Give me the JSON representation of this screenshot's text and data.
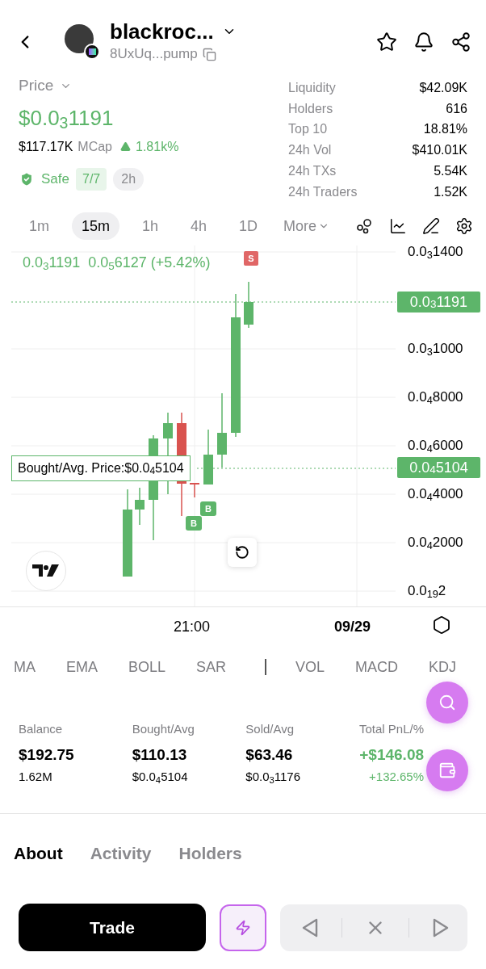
{
  "header": {
    "name": "blackroc...",
    "address": "8UxUq...pump"
  },
  "price": {
    "label": "Price",
    "value": "$0.0$_{3}$1191",
    "mcap": "$117.17K",
    "mcap_label": "MCap",
    "change": "1.81k%",
    "safe": true,
    "safe_label": "Safe",
    "checks": "7/7",
    "age": "2h"
  },
  "stats": [
    {
      "label": "Liquidity",
      "value": "$42.09K"
    },
    {
      "label": "Holders",
      "value": "616"
    },
    {
      "label": "Top 10",
      "value": "18.81%"
    },
    {
      "label": "24h Vol",
      "value": "$410.01K"
    },
    {
      "label": "24h TXs",
      "value": "5.54K"
    },
    {
      "label": "24h Traders",
      "value": "1.52K"
    }
  ],
  "timeframes": [
    {
      "label": "1m",
      "selected": false
    },
    {
      "label": "15m",
      "selected": true
    },
    {
      "label": "1h",
      "selected": false
    },
    {
      "label": "4h",
      "selected": false
    },
    {
      "label": "1D",
      "selected": false
    }
  ],
  "more": "More",
  "chart": {
    "legend_price": "0.0$_{3}$1191",
    "legend_change": "0.0$_{5}$6127 (+5.42%)",
    "sell_marker": "S",
    "buy_markers": [
      "B",
      "B"
    ],
    "y_labels": [
      "0.0$_{3}$1400",
      "0.0$_{3}$1000",
      "0.0$_{4}$8000",
      "0.0$_{4}$6000",
      "0.0$_{4}$4000",
      "0.0$_{4}$2000",
      "0.0$_{19}$2"
    ],
    "current_price": "0.0$_{3}$1191",
    "bought_price": "0.0$_{4}$5104",
    "bought_label": "Bought/Avg. Price:$0.0$_{4}$5104",
    "x_labels": [
      "21:00",
      "09/29"
    ]
  },
  "indicators": [
    {
      "label": "MA"
    },
    {
      "label": "EMA"
    },
    {
      "label": "BOLL"
    },
    {
      "label": "SAR"
    },
    {
      "label": "VOL"
    },
    {
      "label": "MACD"
    },
    {
      "label": "KDJ"
    }
  ],
  "position": [
    {
      "label": "Balance",
      "value": "$192.75",
      "sub": "1.62M"
    },
    {
      "label": "Bought/Avg",
      "value": "$110.13",
      "sub": "$0.0$_{4}$5104"
    },
    {
      "label": "Sold/Avg",
      "value": "$63.46",
      "sub": "$0.0$_{3}$1176"
    }
  ],
  "pnl": {
    "label": "Total PnL/%",
    "value": "+$146.08",
    "sub": "+132.65%"
  },
  "tabs": [
    {
      "label": "About",
      "selected": true
    },
    {
      "label": "Activity",
      "selected": false
    },
    {
      "label": "Holders",
      "selected": false
    }
  ],
  "trade_button": "Trade"
}
